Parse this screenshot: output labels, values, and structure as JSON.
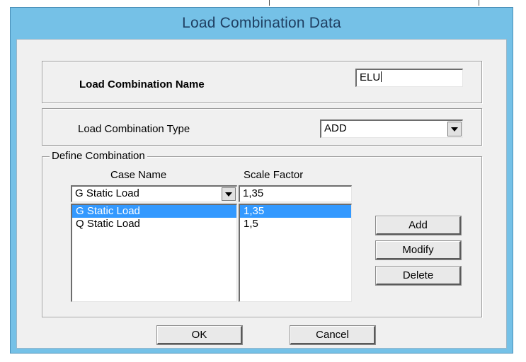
{
  "window": {
    "title": "Load Combination Data"
  },
  "name_group": {
    "label": "Load Combination Name",
    "value": "ELU"
  },
  "type_group": {
    "label": "Load Combination Type",
    "selected": "ADD"
  },
  "define": {
    "title": "Define Combination",
    "case_header": "Case Name",
    "scale_header": "Scale Factor",
    "case_selected": "G Static Load",
    "scale_value": "1,35",
    "case_items": [
      "G Static Load",
      "Q Static Load"
    ],
    "scale_items": [
      "1,35",
      "1,5"
    ],
    "selected_index": 0,
    "add_label": "Add",
    "modify_label": "Modify",
    "delete_label": "Delete"
  },
  "buttons": {
    "ok": "OK",
    "cancel": "Cancel"
  },
  "colors": {
    "title_bar": "#75c1e7",
    "client_bg": "#f0f0f0",
    "selection": "#3399ff"
  }
}
